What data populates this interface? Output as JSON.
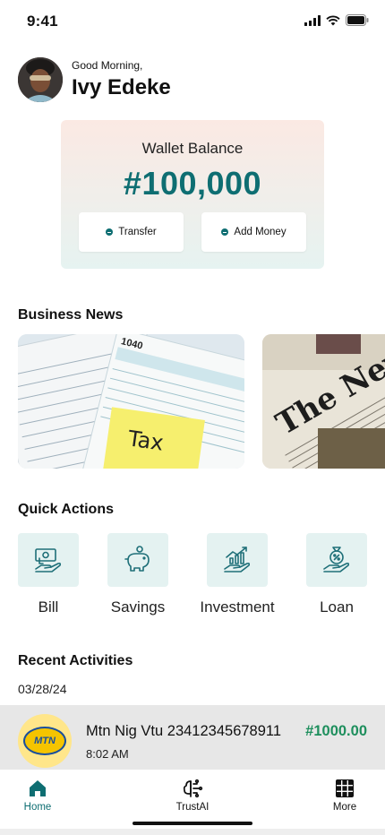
{
  "status_bar": {
    "time": "9:41"
  },
  "header": {
    "greeting": "Good Morning,",
    "name": "Ivy Edeke"
  },
  "wallet": {
    "title": "Wallet Balance",
    "balance": "#100,000",
    "buttons": [
      {
        "label": "Transfer",
        "icon": "plus-circle-icon"
      },
      {
        "label": "Add Money",
        "icon": "plus-circle-icon"
      }
    ]
  },
  "business_news": {
    "title": "Business News",
    "cards": [
      {
        "image": "tax-form-image",
        "visible_text": [
          "1040",
          "Tax"
        ]
      },
      {
        "image": "newspaper-image",
        "visible_text": [
          "The New"
        ]
      }
    ]
  },
  "quick_actions": {
    "title": "Quick Actions",
    "items": [
      {
        "label": "Bill",
        "icon": "bill-icon"
      },
      {
        "label": "Savings",
        "icon": "piggy-bank-icon"
      },
      {
        "label": "Investment",
        "icon": "investment-icon"
      },
      {
        "label": "Loan",
        "icon": "loan-icon"
      }
    ]
  },
  "recent_activities": {
    "title": "Recent Activities",
    "date": "03/28/24",
    "items": [
      {
        "logo_text": "MTN",
        "title": "Mtn Nig Vtu 23412345678911",
        "time": "8:02 AM",
        "amount": "#1000.00"
      }
    ]
  },
  "bottom_nav": {
    "items": [
      {
        "label": "Home",
        "icon": "home-icon",
        "active": true
      },
      {
        "label": "TrustAI",
        "icon": "ai-brain-icon",
        "active": false
      },
      {
        "label": "More",
        "icon": "grid-icon",
        "active": false
      }
    ]
  },
  "colors": {
    "accent": "#0e6e72",
    "amount_green": "#1e8f5d",
    "tile_bg": "#e4f2f1"
  }
}
